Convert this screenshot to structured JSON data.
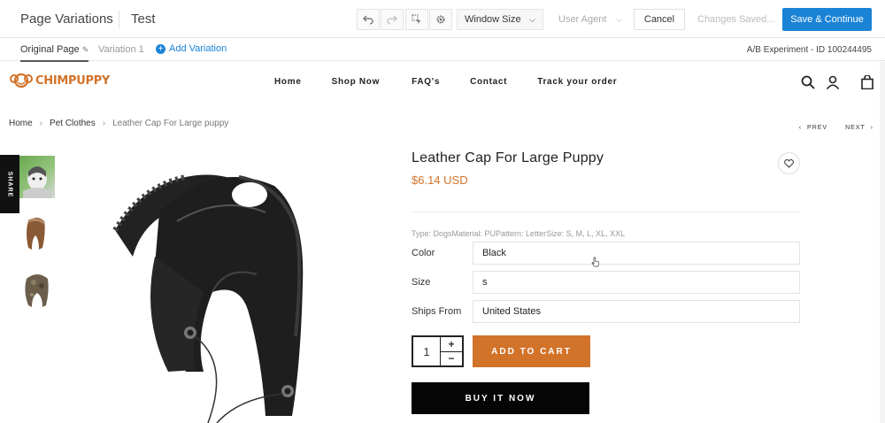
{
  "editor": {
    "title": "Page Variations",
    "name": "Test",
    "window_size_label": "Window Size",
    "user_agent_label": "User Agent",
    "cancel_label": "Cancel",
    "changes_saved": "Changes Saved...",
    "save_label": "Save & Continue",
    "accent_color": "#1a83d6"
  },
  "variations": {
    "original_label": "Original Page",
    "variation1_label": "Variation 1",
    "add_label": "Add Variation",
    "experiment_id": "A/B Experiment - ID 100244495"
  },
  "store": {
    "logo_text": "CHIMPUPPY",
    "brand_color": "#d2732a",
    "nav": [
      "Home",
      "Shop Now",
      "FAQ's",
      "Contact",
      "Track your order"
    ]
  },
  "breadcrumb": {
    "items": [
      "Home",
      "Pet Clothes",
      "Leather Cap For Large puppy"
    ],
    "separator": "›"
  },
  "pager": {
    "prev": "PREV",
    "next": "NEXT"
  },
  "share_label": "SHARE",
  "product": {
    "name": "Leather Cap For Large Puppy",
    "price": "$6.14 USD",
    "meta": "Type: DogsMaterial: PUPattern: LetterSize: S, M, L, XL, XXL",
    "options": [
      {
        "label": "Color",
        "value": "Black"
      },
      {
        "label": "Size",
        "value": "s"
      },
      {
        "label": "Ships From",
        "value": "United States"
      }
    ],
    "quantity": "1",
    "add_to_cart": "ADD TO CART",
    "buy_now": "BUY IT NOW"
  }
}
